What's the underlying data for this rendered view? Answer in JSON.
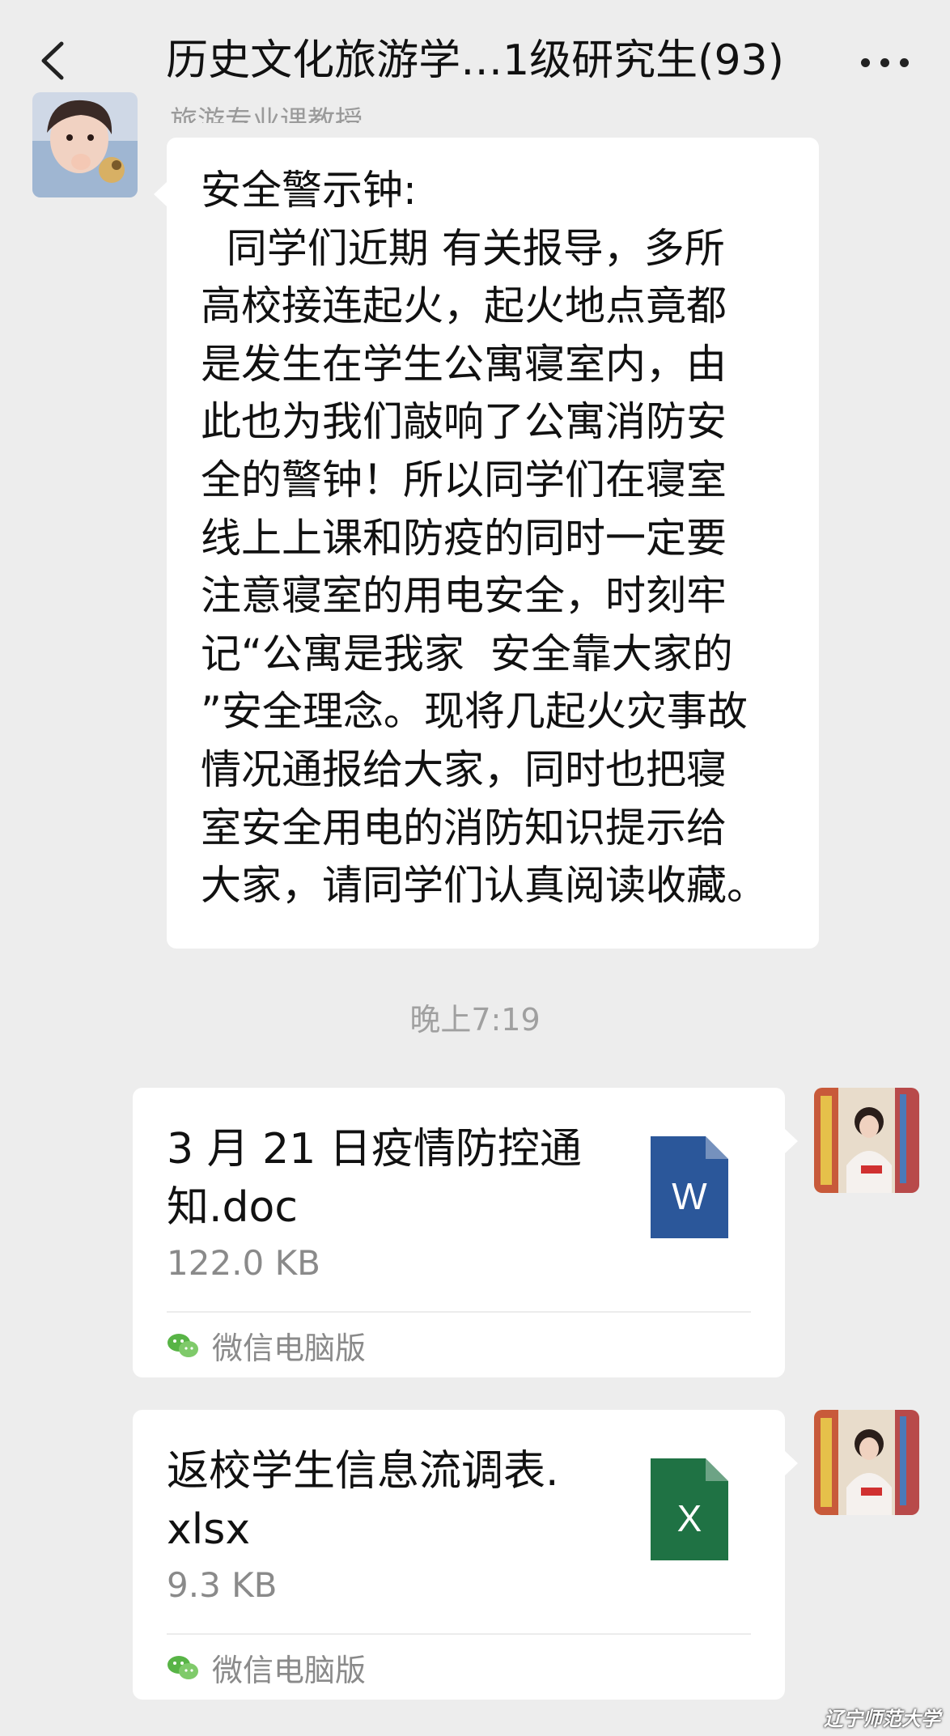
{
  "header": {
    "title": "历史文化旅游学…1级研究生(93)",
    "back_icon": "chevron-left-icon",
    "more_icon": "more-dots-icon"
  },
  "messages": [
    {
      "sender_name": "旅游专业课教授",
      "text": "安全警示钟:\n  同学们近期 有关报导，多所\n高校接连起火，起火地点竟都\n是发生在学生公寓寝室内，由\n此也为我们敲响了公寓消防安\n全的警钟！所以同学们在寝室\n线上上课和防疫的同时一定要\n注意寝室的用电安全，时刻牢\n记“公寓是我家  安全靠大家的\n”安全理念。现将几起火灾事故\n情况通报给大家，同时也把寝\n室安全用电的消防知识提示给\n大家，请同学们认真阅读收藏。"
    }
  ],
  "timestamp": "晚上7:19",
  "files": [
    {
      "name": "3 月 21 日疫情防控通\n知.doc",
      "size": "122.0 KB",
      "source": "微信电脑版",
      "icon_letter": "W",
      "icon_color": "#2b579a",
      "icon": "word-file-icon"
    },
    {
      "name": "返校学生信息流调表.\nxlsx",
      "size": "9.3 KB",
      "source": "微信电脑版",
      "icon_letter": "X",
      "icon_color": "#1f7244",
      "icon": "excel-file-icon"
    }
  ],
  "watermark": "辽宁师范大学"
}
